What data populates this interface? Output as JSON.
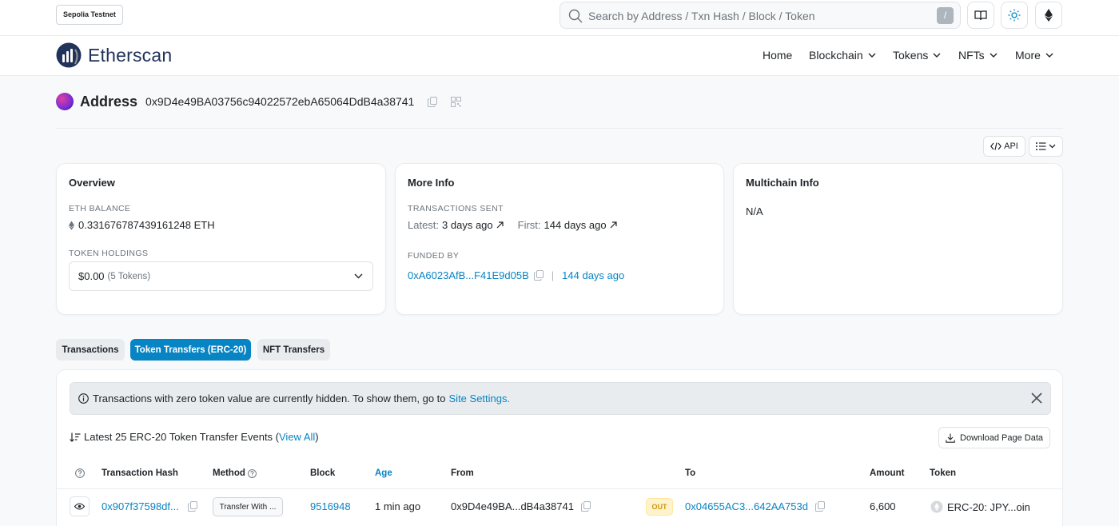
{
  "topbar": {
    "network": "Sepolia Testnet",
    "search_placeholder": "Search by Address / Txn Hash / Block / Token",
    "slash_key": "/"
  },
  "nav": {
    "brand": "Etherscan",
    "items": [
      {
        "label": "Home",
        "dropdown": false
      },
      {
        "label": "Blockchain",
        "dropdown": true
      },
      {
        "label": "Tokens",
        "dropdown": true
      },
      {
        "label": "NFTs",
        "dropdown": true
      },
      {
        "label": "More",
        "dropdown": true
      }
    ]
  },
  "address": {
    "title": "Address",
    "hash": "0x9D4e49BA03756c94022572ebA65064DdB4a38741"
  },
  "toolbar": {
    "api_label": "API"
  },
  "overview": {
    "title": "Overview",
    "eth_balance_label": "ETH BALANCE",
    "eth_balance": "0.331676787439161248 ETH",
    "token_holdings_label": "TOKEN HOLDINGS",
    "token_value": "$0.00",
    "token_count": "(5 Tokens)"
  },
  "more_info": {
    "title": "More Info",
    "tx_sent_label": "TRANSACTIONS SENT",
    "latest_label": "Latest:",
    "latest_value": "3 days ago",
    "first_label": "First:",
    "first_value": "144 days ago",
    "funded_by_label": "FUNDED BY",
    "funded_by_address": "0xA6023AfB...F41E9d05B",
    "funded_separator": "|",
    "funded_age": "144 days ago"
  },
  "multichain": {
    "title": "Multichain Info",
    "value": "N/A"
  },
  "tabs": [
    {
      "label": "Transactions",
      "active": false
    },
    {
      "label": "Token Transfers (ERC-20)",
      "active": true
    },
    {
      "label": "NFT Transfers",
      "active": false
    }
  ],
  "alert": {
    "text": "Transactions with zero token value are currently hidden. To show them, go to",
    "link": "Site Settings."
  },
  "events": {
    "prefix": "Latest 25 ERC-20 Token Transfer Events (",
    "link": "View All",
    "suffix": ")",
    "download_label": "Download Page Data"
  },
  "table": {
    "headers": {
      "hash": "Transaction Hash",
      "method": "Method",
      "block": "Block",
      "age": "Age",
      "from": "From",
      "to": "To",
      "amount": "Amount",
      "token": "Token"
    },
    "rows": [
      {
        "hash": "0x907f37598df...",
        "method": "Transfer With ...",
        "block": "9516948",
        "age": "1 min ago",
        "from": "0x9D4e49BA...dB4a38741",
        "direction": "OUT",
        "to": "0x04655AC3...642AA753d",
        "amount": "6,600",
        "token": "ERC-20: JPY...oin"
      }
    ]
  },
  "colors": {
    "accent": "#0784c3",
    "brand_navy": "#21325b",
    "out_badge": "#cc9a06"
  }
}
